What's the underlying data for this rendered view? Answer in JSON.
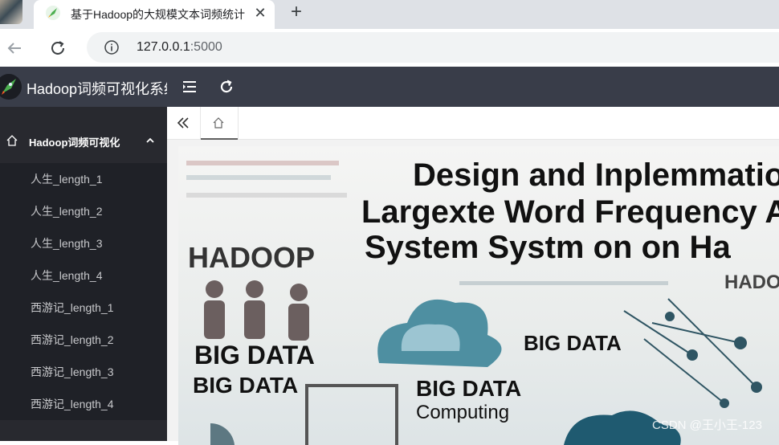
{
  "browser": {
    "tab_title": "基于Hadoop的大规模文本词频统计",
    "url_host": "127.0.0.1",
    "url_port": ":5000",
    "colors": {
      "tabbar": "#dee1e6",
      "omnibox": "#f1f3f4"
    }
  },
  "app": {
    "title": "Hadoop词频可视化系统",
    "colors": {
      "header": "#393d49",
      "sidebar": "#28292f",
      "submenu": "#1f2127"
    }
  },
  "sidebar": {
    "group_label": "Hadoop词频可视化",
    "items": [
      "人生_length_1",
      "人生_length_2",
      "人生_length_3",
      "人生_length_4",
      "西游记_length_1",
      "西游记_length_2",
      "西游记_length_3",
      "西游记_length_4"
    ]
  },
  "banner": {
    "title_line1": "Design and Inplemmatio",
    "title_line2": "Largexte Word Frequency A",
    "title_line3": "System Systm on on Ha",
    "hadoop_left": "HADOOP",
    "hadoop_right": "HADOOP",
    "big_data_1": "BIG DATA",
    "big_data_2": "BIG DATA",
    "big_data_3": "BIG DATA",
    "big_data_4": "BIG DATA",
    "computing": "Computing",
    "watermark": "CSDN @王小王-123"
  }
}
